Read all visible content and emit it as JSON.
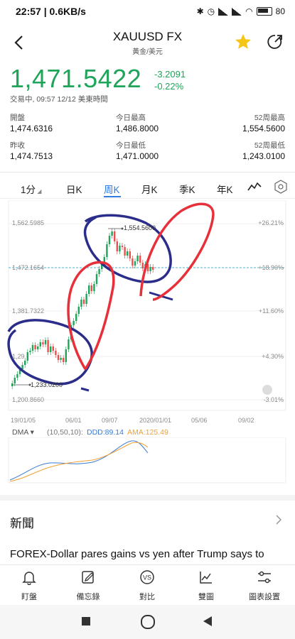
{
  "status_bar": {
    "time": "22:57",
    "speed": "0.6KB/s",
    "battery": "80"
  },
  "header": {
    "title": "XAUUSD FX",
    "subtitle": "黃金/美元"
  },
  "quote": {
    "price": "1,471.5422",
    "change": "-3.2091",
    "change_pct": "-0.22%",
    "status": "交易中, 09:57 12/12 美東時間",
    "color": "#1fa55a"
  },
  "stats": [
    {
      "label": "開盤",
      "value": "1,474.6316"
    },
    {
      "label": "今日最高",
      "value": "1,486.8000"
    },
    {
      "label": "52周最高",
      "value": "1,554.5600"
    },
    {
      "label": "昨收",
      "value": "1,474.7513"
    },
    {
      "label": "今日最低",
      "value": "1,471.0000"
    },
    {
      "label": "52周最低",
      "value": "1,243.0100"
    }
  ],
  "tabs": [
    "1分",
    "日K",
    "周K",
    "月K",
    "季K",
    "年K"
  ],
  "active_tab": "周K",
  "chart": {
    "y_labels": [
      "1,562.5985",
      "1,472.1654",
      "1,381.7322",
      "1,29",
      "1,200.8660"
    ],
    "pct_labels": [
      "+26.21%",
      "+18.90%",
      "+11.60%",
      "+4.30%",
      "-3.01%"
    ],
    "x_labels": [
      "19/01/05",
      "06/01",
      "09/07",
      "2020/01/01",
      "05/06",
      "09/02"
    ],
    "high_marker": "1,554.5600",
    "low_marker": "1,233.0200",
    "current_line_color": "#4ab0c8",
    "up_color": "#1fa55a",
    "down_color": "#e84f4f"
  },
  "indicator": {
    "name": "DMA",
    "params": "(10,50,10):",
    "ddd": "DDD:89.14",
    "ama": "AMA:125.49",
    "ddd_color": "#3a7bd5",
    "ama_color": "#f0a030"
  },
  "news": {
    "title": "新聞",
    "first_item": "FOREX-Dollar pares gains vs yen after Trump says to"
  },
  "toolbar": [
    "盯盤",
    "備忘錄",
    "對比",
    "雙圖",
    "圖表設置"
  ]
}
